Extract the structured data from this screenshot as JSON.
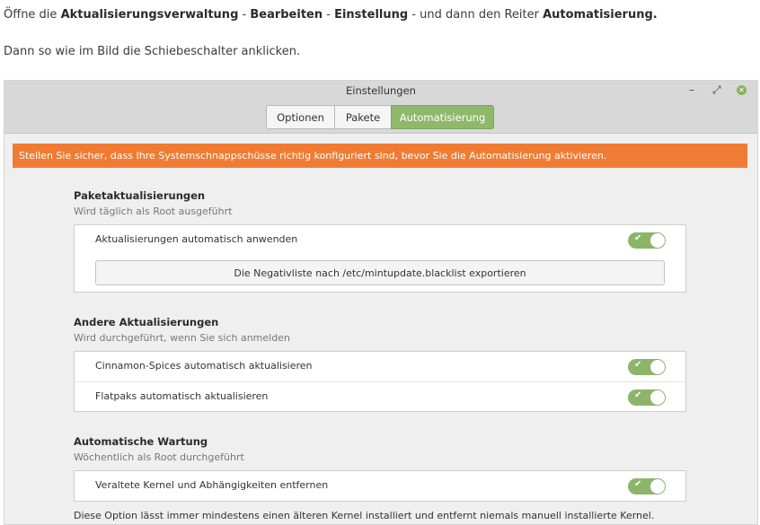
{
  "intro": {
    "line1": {
      "prefix": "Öffne die ",
      "bold1": "Aktualisierungsverwaltung",
      "sep1": " - ",
      "bold2": "Bearbeiten",
      "sep2": " - ",
      "bold3": "Einstellung",
      "sep3": " - und dann den Reiter ",
      "bold4": "Automatisierung."
    },
    "line2": "Dann so wie im Bild die Schiebeschalter anklicken."
  },
  "window": {
    "title": "Einstellungen",
    "controls": {
      "minimize": "–",
      "maximize": "⤢",
      "close": "✕"
    },
    "tabs": [
      {
        "label": "Optionen",
        "active": false
      },
      {
        "label": "Pakete",
        "active": false
      },
      {
        "label": "Automatisierung",
        "active": true
      }
    ],
    "warning": "Stellen Sie sicher, dass Ihre Systemschnappschüsse richtig konfiguriert sind, bevor Sie die Automatisierung aktivieren.",
    "sections": [
      {
        "title": "Paketaktualisierungen",
        "subtitle": "Wird täglich als Root ausgeführt",
        "rows": [
          {
            "label": "Aktualisierungen automatisch anwenden",
            "enabled": true
          }
        ],
        "button": "Die Negativliste nach /etc/mintupdate.blacklist exportieren"
      },
      {
        "title": "Andere Aktualisierungen",
        "subtitle": "Wird durchgeführt, wenn Sie sich anmelden",
        "rows": [
          {
            "label": "Cinnamon-Spices automatisch aktualisieren",
            "enabled": true
          },
          {
            "label": "Flatpaks automatisch aktualisieren",
            "enabled": true
          }
        ]
      },
      {
        "title": "Automatische Wartung",
        "subtitle": "Wöchentlich als Root durchgeführt",
        "rows": [
          {
            "label": "Veraltete Kernel und Abhängigkeiten entfernen",
            "enabled": true
          }
        ],
        "note": "Diese Option lässt immer mindestens einen älteren Kernel installiert und entfernt niemals manuell installierte Kernel."
      }
    ],
    "toggle_check": "✔"
  },
  "colors": {
    "accent": "#8fb86a",
    "warning": "#f07c33",
    "toggle_on": "#8db56a"
  }
}
